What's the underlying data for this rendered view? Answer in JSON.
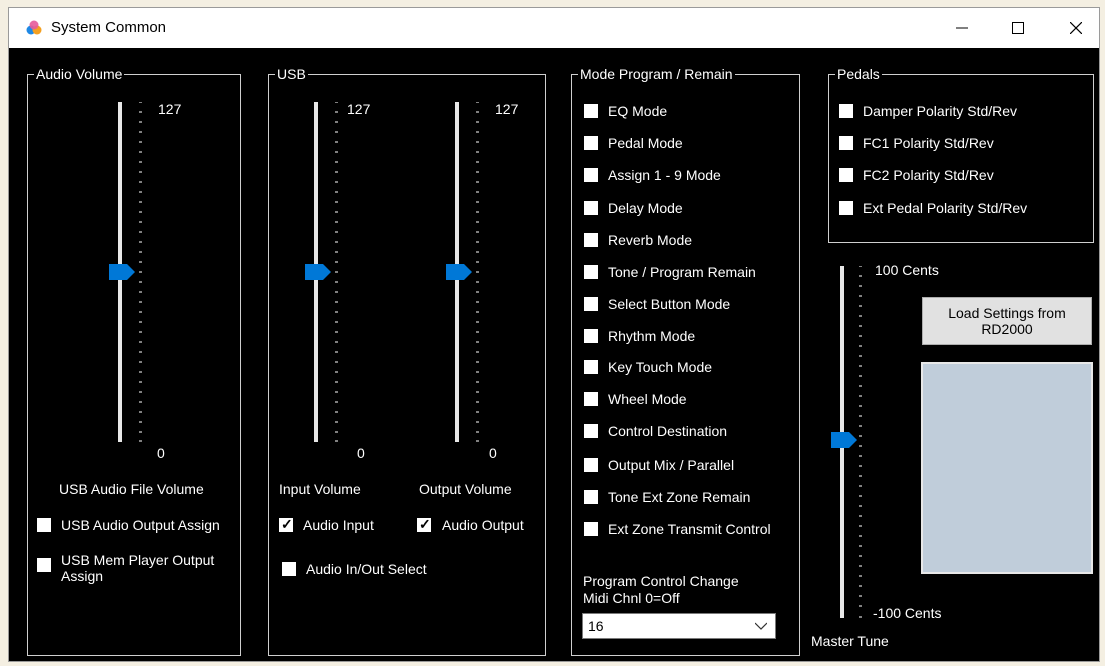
{
  "window": {
    "title": "System Common",
    "minimize_glyph": "—",
    "maximize_glyph": "☐",
    "close_glyph": "✕"
  },
  "audio_volume": {
    "group_title": "Audio Volume",
    "slider": {
      "max_label": "127",
      "min_label": "0",
      "value_fraction": 0.5
    },
    "slider_caption": "USB Audio File Volume",
    "checkboxes": [
      {
        "label": "USB Audio Output Assign",
        "checked": false
      },
      {
        "label": "USB Mem Player Output Assign",
        "checked": false
      }
    ]
  },
  "usb": {
    "group_title": "USB",
    "input_slider": {
      "max_label": "127",
      "min_label": "0",
      "caption": "Input Volume",
      "value_fraction": 0.5
    },
    "output_slider": {
      "max_label": "127",
      "min_label": "0",
      "caption": "Output Volume",
      "value_fraction": 0.5
    },
    "audio_input": {
      "label": "Audio Input",
      "checked": true
    },
    "audio_output": {
      "label": "Audio Output",
      "checked": true
    },
    "audio_in_out_select": {
      "label": "Audio In/Out Select",
      "checked": false
    }
  },
  "mode_program": {
    "group_title": "Mode Program / Remain",
    "items": [
      {
        "label": "EQ Mode",
        "checked": false
      },
      {
        "label": "Pedal Mode",
        "checked": false
      },
      {
        "label": "Assign 1 - 9 Mode",
        "checked": false
      },
      {
        "label": "Delay Mode",
        "checked": false
      },
      {
        "label": "Reverb Mode",
        "checked": false
      },
      {
        "label": "Tone / Program Remain",
        "checked": false
      },
      {
        "label": "Select Button Mode",
        "checked": false
      },
      {
        "label": "Rhythm Mode",
        "checked": false
      },
      {
        "label": "Key Touch Mode",
        "checked": false
      },
      {
        "label": "Wheel Mode",
        "checked": false
      },
      {
        "label": "Control Destination",
        "checked": false
      },
      {
        "label": "Output Mix / Parallel",
        "checked": false
      },
      {
        "label": "Tone Ext Zone Remain",
        "checked": false
      },
      {
        "label": "Ext Zone Transmit Control",
        "checked": false
      }
    ],
    "program_control_label_line1": "Program Control Change",
    "program_control_label_line2": "Midi Chnl 0=Off",
    "midi_channel_value": "16"
  },
  "pedals": {
    "group_title": "Pedals",
    "items": [
      {
        "label": "Damper Polarity Std/Rev",
        "checked": false
      },
      {
        "label": "FC1 Polarity Std/Rev",
        "checked": false
      },
      {
        "label": "FC2 Polarity Std/Rev",
        "checked": false
      },
      {
        "label": "Ext Pedal Polarity Std/Rev",
        "checked": false
      }
    ]
  },
  "master_tune": {
    "max_label": "100 Cents",
    "min_label": "-100 Cents",
    "caption": "Master Tune",
    "value_fraction": 0.5
  },
  "load_button": {
    "line1": "Load Settings from",
    "line2": "RD2000"
  },
  "colors": {
    "thumb": "#0078d7",
    "panel": "#c0cdda",
    "background": "#000000"
  }
}
